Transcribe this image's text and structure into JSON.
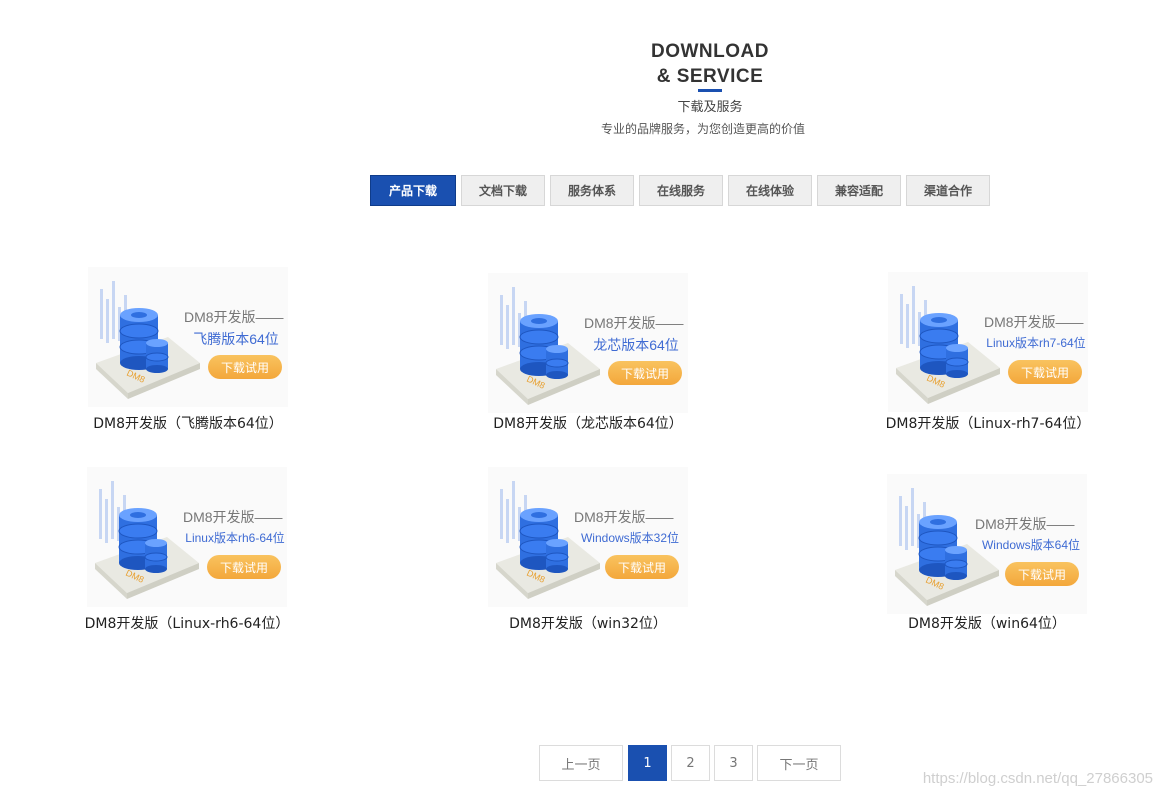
{
  "header": {
    "title_line1": "DOWNLOAD",
    "title_line2": "& SERVICE",
    "subtitle": "下载及服务",
    "slogan": "专业的品牌服务，为您创造更高的价值"
  },
  "tabs": [
    {
      "label": "产品下载",
      "active": true
    },
    {
      "label": "文档下载",
      "active": false
    },
    {
      "label": "服务体系",
      "active": false
    },
    {
      "label": "在线服务",
      "active": false
    },
    {
      "label": "在线体验",
      "active": false
    },
    {
      "label": "兼容适配",
      "active": false
    },
    {
      "label": "渠道合作",
      "active": false
    }
  ],
  "products": [
    {
      "banner_title": "DM8开发版——",
      "banner_variant": "飞腾版本64位",
      "button": "下载试用",
      "caption": "DM8开发版（飞腾版本64位）"
    },
    {
      "banner_title": "DM8开发版——",
      "banner_variant": "龙芯版本64位",
      "button": "下载试用",
      "caption": "DM8开发版（龙芯版本64位）"
    },
    {
      "banner_title": "DM8开发版——",
      "banner_variant": "Linux版本rh7-64位",
      "button": "下载试用",
      "caption": "DM8开发版（Linux-rh7-64位）"
    },
    {
      "banner_title": "DM8开发版——",
      "banner_variant": "Linux版本rh6-64位",
      "button": "下载试用",
      "caption": "DM8开发版（Linux-rh6-64位）"
    },
    {
      "banner_title": "DM8开发版——",
      "banner_variant": "Windows版本32位",
      "button": "下载试用",
      "caption": "DM8开发版（win32位）"
    },
    {
      "banner_title": "DM8开发版——",
      "banner_variant": "Windows版本64位",
      "button": "下载试用",
      "caption": "DM8开发版（win64位）"
    }
  ],
  "pagination": {
    "prev": "上一页",
    "pages": [
      "1",
      "2",
      "3"
    ],
    "current": "1",
    "next": "下一页"
  },
  "watermark": "https://blog.csdn.net/qq_27866305",
  "colors": {
    "accent": "#1a50b0",
    "button_orange": "#f5ae44",
    "variant_blue": "#3f6bd3"
  }
}
